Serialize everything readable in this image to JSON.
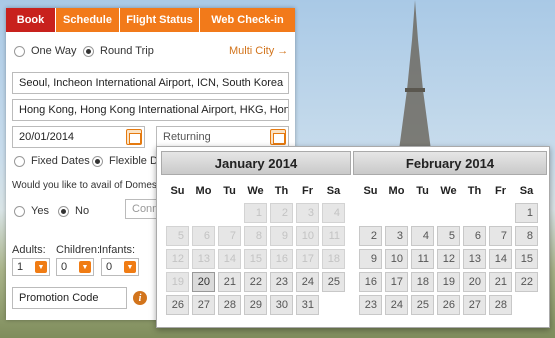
{
  "tabs": [
    "Book",
    "Schedule",
    "Flight Status",
    "Web Check-in"
  ],
  "trip": {
    "one_way": "One Way",
    "round_trip": "Round Trip",
    "multi_city": "Multi City →"
  },
  "origin": "Seoul, Incheon International Airport, ICN, South Korea",
  "destination": "Hong Kong, Hong Kong International Airport, HKG, Hong Kong",
  "depart_date": "20/01/2014",
  "return_placeholder": "Returning",
  "date_opts": {
    "fixed": "Fixed Dates",
    "flexible": "Flexible Dates"
  },
  "domestic_q": "Would you like to avail of Domestic Connections?",
  "yes": "Yes",
  "no": "No",
  "conn_placeholder": "Connecting city",
  "pax": {
    "adults_label": "Adults:",
    "children_label": "Children:",
    "infants_label": "Infants:",
    "adults": "1",
    "children": "0",
    "infants": "0"
  },
  "promo_placeholder": "Promotion Code",
  "colors": {
    "accent": "#f27a1a",
    "active_tab": "#c8211d"
  },
  "calendar": {
    "weekdays": [
      "Su",
      "Mo",
      "Tu",
      "We",
      "Th",
      "Fr",
      "Sa"
    ],
    "months": [
      {
        "title": "January 2014",
        "weeks": [
          [
            "",
            "",
            "",
            "1",
            "2",
            "3",
            "4"
          ],
          [
            "5",
            "6",
            "7",
            "8",
            "9",
            "10",
            "11"
          ],
          [
            "12",
            "13",
            "14",
            "15",
            "16",
            "17",
            "18"
          ],
          [
            "19",
            "20",
            "21",
            "22",
            "23",
            "24",
            "25"
          ],
          [
            "26",
            "27",
            "28",
            "29",
            "30",
            "31",
            ""
          ]
        ],
        "disabled_until": 19,
        "today": "20"
      },
      {
        "title": "February 2014",
        "weeks": [
          [
            "",
            "",
            "",
            "",
            "",
            "",
            "1"
          ],
          [
            "2",
            "3",
            "4",
            "5",
            "6",
            "7",
            "8"
          ],
          [
            "9",
            "10",
            "11",
            "12",
            "13",
            "14",
            "15"
          ],
          [
            "16",
            "17",
            "18",
            "19",
            "20",
            "21",
            "22"
          ],
          [
            "23",
            "24",
            "25",
            "26",
            "27",
            "28",
            ""
          ]
        ],
        "disabled_until": 0,
        "today": ""
      }
    ]
  }
}
